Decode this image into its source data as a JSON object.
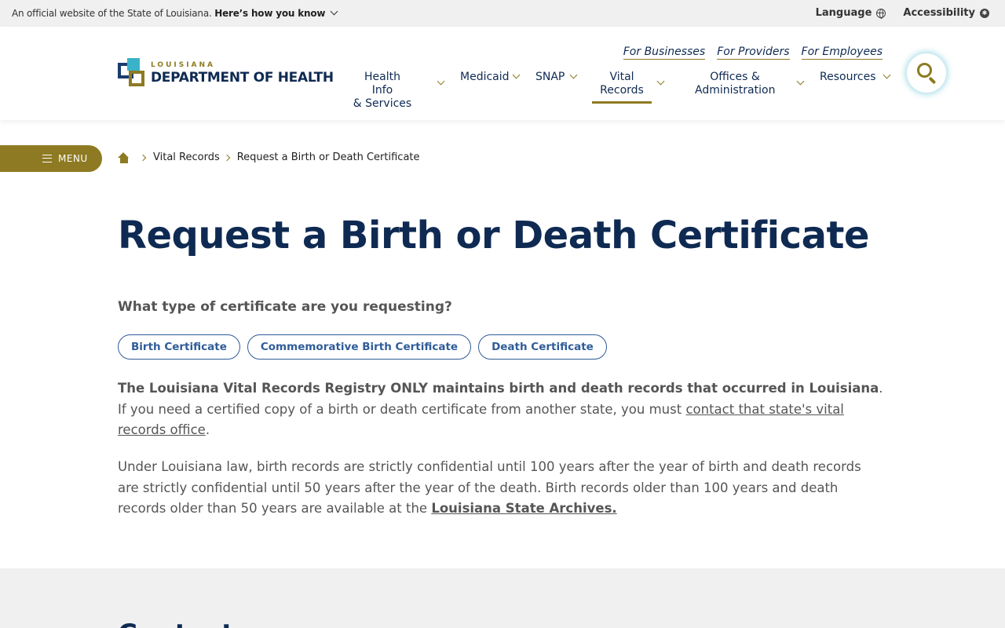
{
  "gov_banner": {
    "text": "An official website of the State of Louisiana.",
    "link": "Here’s how you know",
    "language": "Language",
    "accessibility": "Accessibility",
    "accessibility_glyph": "✱"
  },
  "header": {
    "logo_small": "LOUISIANA",
    "logo_big": "DEPARTMENT OF HEALTH",
    "quick_links": [
      "For Businesses",
      "For Providers",
      "For Employees"
    ],
    "nav": [
      {
        "line1": "Health Info",
        "line2": "& Services"
      },
      {
        "line1": "Medicaid",
        "line2": ""
      },
      {
        "line1": "SNAP",
        "line2": ""
      },
      {
        "line1": "Vital",
        "line2": "Records"
      },
      {
        "line1": "Offices &",
        "line2": "Administration"
      },
      {
        "line1": "Resources",
        "line2": ""
      }
    ]
  },
  "menu": {
    "label": "MENU"
  },
  "breadcrumb": {
    "items": [
      "Vital Records",
      "Request a Birth or Death Certificate"
    ]
  },
  "main": {
    "title": "Request a Birth or Death Certificate",
    "question": "What type of certificate are you requesting?",
    "cert_buttons": [
      "Birth Certificate",
      "Commemorative Birth Certificate",
      "Death Certificate"
    ],
    "para1_bold": "The Louisiana Vital Records Registry ONLY maintains birth and death records that occurred in Louisiana",
    "para1_text": ". If you need a certified copy of a birth or death certificate from another state, you must ",
    "para1_link": "contact that state's vital records office",
    "para1_end": ".",
    "para2_text": "Under Louisiana law, birth records are strictly confidential until 100 years after the year of birth and death records are strictly confidential until 50 years after the year of the death. Birth records older than 100 years and death records older than 50 years are available at the ",
    "para2_link": "Louisiana State Archives."
  },
  "footer_peek": {
    "heading": "Contact"
  },
  "colors": {
    "navy": "#0f2a52",
    "gold": "#8e7a22",
    "teal": "#3ab2c9",
    "link_blue": "#2f5c98"
  }
}
